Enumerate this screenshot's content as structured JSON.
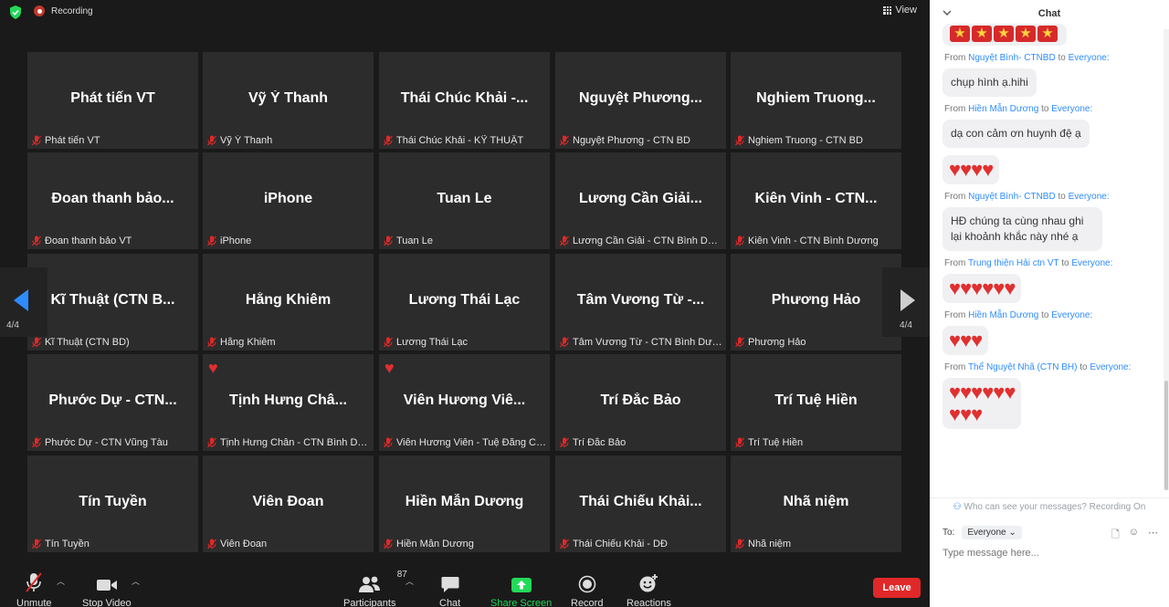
{
  "topbar": {
    "recording_label": "Recording",
    "view_label": "View"
  },
  "pagination": {
    "left": "4/4",
    "right": "4/4"
  },
  "participants": [
    {
      "name": "Phát tiến VT",
      "label": "Phát tiến VT",
      "heart": false
    },
    {
      "name": "Vỹ Ý Thanh",
      "label": "Vỹ Ý Thanh",
      "heart": false
    },
    {
      "name": "Thái Chúc Khải -...",
      "label": "Thái Chúc Khải - KỸ THUẬT",
      "heart": false
    },
    {
      "name": "Nguyệt Phương...",
      "label": "Nguyệt Phương - CTN BD",
      "heart": false
    },
    {
      "name": "Nghiem Truong...",
      "label": "Nghiem Truong - CTN BD",
      "heart": false
    },
    {
      "name": "Đoan thanh bảo...",
      "label": "Đoan thanh bảo VT",
      "heart": false
    },
    {
      "name": "iPhone",
      "label": "iPhone",
      "heart": false
    },
    {
      "name": "Tuan Le",
      "label": "Tuan Le",
      "heart": false
    },
    {
      "name": "Lương Cần Giải...",
      "label": "Lương Cần Giải - CTN Bình Dương",
      "heart": false
    },
    {
      "name": "Kiên Vinh - CTN...",
      "label": "Kiên Vinh - CTN Bình Dương",
      "heart": false
    },
    {
      "name": "Kĩ Thuật (CTN B...",
      "label": "Kĩ Thuật (CTN BD)",
      "heart": false
    },
    {
      "name": "Hằng Khiêm",
      "label": "Hằng Khiêm",
      "heart": false
    },
    {
      "name": "Lương Thái Lạc",
      "label": "Lương Thái Lạc",
      "heart": false
    },
    {
      "name": "Tâm Vương Từ -...",
      "label": "Tâm Vương Từ - CTN Bình Dương",
      "heart": false
    },
    {
      "name": "Phương Hảo",
      "label": "Phương Hảo",
      "heart": false
    },
    {
      "name": "Phước Dự - CTN...",
      "label": "Phước Dự - CTN Vũng Tàu",
      "heart": false
    },
    {
      "name": "Tịnh Hưng Châ...",
      "label": "Tịnh Hưng Chân - CTN Bình Dương",
      "heart": true
    },
    {
      "name": "Viên Hương Viê...",
      "label": "Viên Hương Viên - Tuệ Đăng CTN ...",
      "heart": true
    },
    {
      "name": "Trí Đắc Bảo",
      "label": "Trí Đắc Bảo",
      "heart": false
    },
    {
      "name": "Trí Tuệ Hiền",
      "label": "Trí Tuệ Hiền",
      "heart": false
    },
    {
      "name": "Tín Tuyền",
      "label": "Tín Tuyền",
      "heart": false
    },
    {
      "name": "Viên Đoan",
      "label": "Viên Đoan",
      "heart": false
    },
    {
      "name": "Hiền Mẫn Dương",
      "label": "Hiền Mẫn Dương",
      "heart": false
    },
    {
      "name": "Thái Chiếu Khải...",
      "label": "Thái Chiếu Khải - DĐ",
      "heart": false
    },
    {
      "name": "Nhã niệm",
      "label": "Nhã niệm",
      "heart": false
    }
  ],
  "toolbar": {
    "unmute": "Unmute",
    "stop_video": "Stop Video",
    "participants": "Participants",
    "participants_count": "87",
    "chat": "Chat",
    "share_screen": "Share Screen",
    "record": "Record",
    "reactions": "Reactions",
    "leave": "Leave"
  },
  "chat": {
    "title": "Chat",
    "privacy_note": "Who can see your messages? Recording On",
    "to_label": "To:",
    "to_value": "Everyone",
    "placeholder": "Type message here...",
    "messages": [
      {
        "from": "",
        "to": "",
        "text": "",
        "stars": 5,
        "hearts": 0
      },
      {
        "from": "Nguyệt Bình- CTNBD",
        "to": "Everyone:",
        "text": "chụp hình ạ.hihi",
        "stars": 0,
        "hearts": 0
      },
      {
        "from": "Hiền Mẫn Dương",
        "to": "Everyone:",
        "text": "dạ con cảm ơn huynh đệ ạ",
        "stars": 0,
        "hearts": 0
      },
      {
        "from": "",
        "to": "",
        "text": "",
        "stars": 0,
        "hearts": 4
      },
      {
        "from": "Nguyệt Bình- CTNBD",
        "to": "Everyone:",
        "text": "HĐ chúng ta cùng nhau ghi lại khoảnh khắc này nhé ạ",
        "stars": 0,
        "hearts": 0
      },
      {
        "from": "Trung thiện Hải ctn VT",
        "to": "Everyone:",
        "text": "",
        "stars": 0,
        "hearts": 6
      },
      {
        "from": "Hiền Mẫn Dương",
        "to": "Everyone:",
        "text": "",
        "stars": 0,
        "hearts": 3
      },
      {
        "from": "Thể Nguyệt Nhã (CTN BH)",
        "to": "Everyone:",
        "text": "",
        "stars": 0,
        "hearts": 9
      }
    ]
  },
  "colors": {
    "leave": "#e02828",
    "share": "#23d959",
    "link": "#2d8cff",
    "heart": "#e0302f"
  }
}
